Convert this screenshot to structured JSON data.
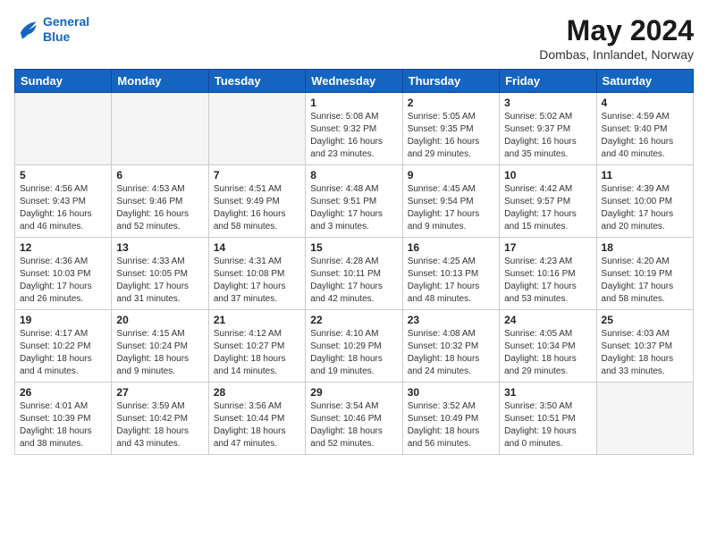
{
  "header": {
    "logo_line1": "General",
    "logo_line2": "Blue",
    "month": "May 2024",
    "location": "Dombas, Innlandet, Norway"
  },
  "days_of_week": [
    "Sunday",
    "Monday",
    "Tuesday",
    "Wednesday",
    "Thursday",
    "Friday",
    "Saturday"
  ],
  "weeks": [
    [
      {
        "day": "",
        "empty": true
      },
      {
        "day": "",
        "empty": true
      },
      {
        "day": "",
        "empty": true
      },
      {
        "day": "1",
        "line1": "Sunrise: 5:08 AM",
        "line2": "Sunset: 9:32 PM",
        "line3": "Daylight: 16 hours",
        "line4": "and 23 minutes."
      },
      {
        "day": "2",
        "line1": "Sunrise: 5:05 AM",
        "line2": "Sunset: 9:35 PM",
        "line3": "Daylight: 16 hours",
        "line4": "and 29 minutes."
      },
      {
        "day": "3",
        "line1": "Sunrise: 5:02 AM",
        "line2": "Sunset: 9:37 PM",
        "line3": "Daylight: 16 hours",
        "line4": "and 35 minutes."
      },
      {
        "day": "4",
        "line1": "Sunrise: 4:59 AM",
        "line2": "Sunset: 9:40 PM",
        "line3": "Daylight: 16 hours",
        "line4": "and 40 minutes."
      }
    ],
    [
      {
        "day": "5",
        "line1": "Sunrise: 4:56 AM",
        "line2": "Sunset: 9:43 PM",
        "line3": "Daylight: 16 hours",
        "line4": "and 46 minutes."
      },
      {
        "day": "6",
        "line1": "Sunrise: 4:53 AM",
        "line2": "Sunset: 9:46 PM",
        "line3": "Daylight: 16 hours",
        "line4": "and 52 minutes."
      },
      {
        "day": "7",
        "line1": "Sunrise: 4:51 AM",
        "line2": "Sunset: 9:49 PM",
        "line3": "Daylight: 16 hours",
        "line4": "and 58 minutes."
      },
      {
        "day": "8",
        "line1": "Sunrise: 4:48 AM",
        "line2": "Sunset: 9:51 PM",
        "line3": "Daylight: 17 hours",
        "line4": "and 3 minutes."
      },
      {
        "day": "9",
        "line1": "Sunrise: 4:45 AM",
        "line2": "Sunset: 9:54 PM",
        "line3": "Daylight: 17 hours",
        "line4": "and 9 minutes."
      },
      {
        "day": "10",
        "line1": "Sunrise: 4:42 AM",
        "line2": "Sunset: 9:57 PM",
        "line3": "Daylight: 17 hours",
        "line4": "and 15 minutes."
      },
      {
        "day": "11",
        "line1": "Sunrise: 4:39 AM",
        "line2": "Sunset: 10:00 PM",
        "line3": "Daylight: 17 hours",
        "line4": "and 20 minutes."
      }
    ],
    [
      {
        "day": "12",
        "line1": "Sunrise: 4:36 AM",
        "line2": "Sunset: 10:03 PM",
        "line3": "Daylight: 17 hours",
        "line4": "and 26 minutes."
      },
      {
        "day": "13",
        "line1": "Sunrise: 4:33 AM",
        "line2": "Sunset: 10:05 PM",
        "line3": "Daylight: 17 hours",
        "line4": "and 31 minutes."
      },
      {
        "day": "14",
        "line1": "Sunrise: 4:31 AM",
        "line2": "Sunset: 10:08 PM",
        "line3": "Daylight: 17 hours",
        "line4": "and 37 minutes."
      },
      {
        "day": "15",
        "line1": "Sunrise: 4:28 AM",
        "line2": "Sunset: 10:11 PM",
        "line3": "Daylight: 17 hours",
        "line4": "and 42 minutes."
      },
      {
        "day": "16",
        "line1": "Sunrise: 4:25 AM",
        "line2": "Sunset: 10:13 PM",
        "line3": "Daylight: 17 hours",
        "line4": "and 48 minutes."
      },
      {
        "day": "17",
        "line1": "Sunrise: 4:23 AM",
        "line2": "Sunset: 10:16 PM",
        "line3": "Daylight: 17 hours",
        "line4": "and 53 minutes."
      },
      {
        "day": "18",
        "line1": "Sunrise: 4:20 AM",
        "line2": "Sunset: 10:19 PM",
        "line3": "Daylight: 17 hours",
        "line4": "and 58 minutes."
      }
    ],
    [
      {
        "day": "19",
        "line1": "Sunrise: 4:17 AM",
        "line2": "Sunset: 10:22 PM",
        "line3": "Daylight: 18 hours",
        "line4": "and 4 minutes."
      },
      {
        "day": "20",
        "line1": "Sunrise: 4:15 AM",
        "line2": "Sunset: 10:24 PM",
        "line3": "Daylight: 18 hours",
        "line4": "and 9 minutes."
      },
      {
        "day": "21",
        "line1": "Sunrise: 4:12 AM",
        "line2": "Sunset: 10:27 PM",
        "line3": "Daylight: 18 hours",
        "line4": "and 14 minutes."
      },
      {
        "day": "22",
        "line1": "Sunrise: 4:10 AM",
        "line2": "Sunset: 10:29 PM",
        "line3": "Daylight: 18 hours",
        "line4": "and 19 minutes."
      },
      {
        "day": "23",
        "line1": "Sunrise: 4:08 AM",
        "line2": "Sunset: 10:32 PM",
        "line3": "Daylight: 18 hours",
        "line4": "and 24 minutes."
      },
      {
        "day": "24",
        "line1": "Sunrise: 4:05 AM",
        "line2": "Sunset: 10:34 PM",
        "line3": "Daylight: 18 hours",
        "line4": "and 29 minutes."
      },
      {
        "day": "25",
        "line1": "Sunrise: 4:03 AM",
        "line2": "Sunset: 10:37 PM",
        "line3": "Daylight: 18 hours",
        "line4": "and 33 minutes."
      }
    ],
    [
      {
        "day": "26",
        "line1": "Sunrise: 4:01 AM",
        "line2": "Sunset: 10:39 PM",
        "line3": "Daylight: 18 hours",
        "line4": "and 38 minutes."
      },
      {
        "day": "27",
        "line1": "Sunrise: 3:59 AM",
        "line2": "Sunset: 10:42 PM",
        "line3": "Daylight: 18 hours",
        "line4": "and 43 minutes."
      },
      {
        "day": "28",
        "line1": "Sunrise: 3:56 AM",
        "line2": "Sunset: 10:44 PM",
        "line3": "Daylight: 18 hours",
        "line4": "and 47 minutes."
      },
      {
        "day": "29",
        "line1": "Sunrise: 3:54 AM",
        "line2": "Sunset: 10:46 PM",
        "line3": "Daylight: 18 hours",
        "line4": "and 52 minutes."
      },
      {
        "day": "30",
        "line1": "Sunrise: 3:52 AM",
        "line2": "Sunset: 10:49 PM",
        "line3": "Daylight: 18 hours",
        "line4": "and 56 minutes."
      },
      {
        "day": "31",
        "line1": "Sunrise: 3:50 AM",
        "line2": "Sunset: 10:51 PM",
        "line3": "Daylight: 19 hours",
        "line4": "and 0 minutes."
      },
      {
        "day": "",
        "empty": true
      }
    ]
  ]
}
